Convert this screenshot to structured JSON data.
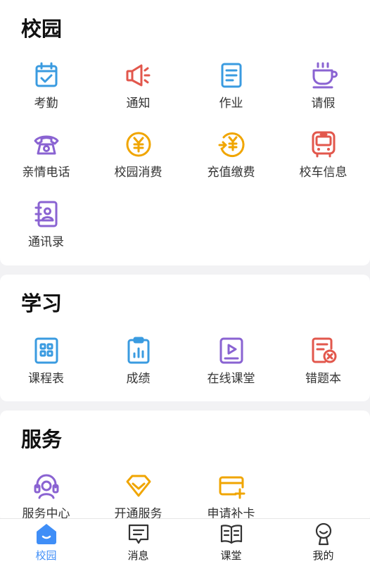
{
  "campus": {
    "title": "校园",
    "items": [
      {
        "label": "考勤",
        "icon": "calendar-check-icon",
        "color": "#3a9be0"
      },
      {
        "label": "通知",
        "icon": "megaphone-icon",
        "color": "#e2574c"
      },
      {
        "label": "作业",
        "icon": "document-list-icon",
        "color": "#3a9be0"
      },
      {
        "label": "请假",
        "icon": "coffee-cup-icon",
        "color": "#8a63d2"
      },
      {
        "label": "亲情电话",
        "icon": "telephone-icon",
        "color": "#8a63d2"
      },
      {
        "label": "校园消费",
        "icon": "yen-coin-icon",
        "color": "#f0a500"
      },
      {
        "label": "充值缴费",
        "icon": "yen-recharge-icon",
        "color": "#f0a500"
      },
      {
        "label": "校车信息",
        "icon": "bus-icon",
        "color": "#e2574c"
      },
      {
        "label": "通讯录",
        "icon": "contact-book-icon",
        "color": "#8a63d2"
      }
    ]
  },
  "study": {
    "title": "学习",
    "items": [
      {
        "label": "课程表",
        "icon": "timetable-grid-icon",
        "color": "#3a9be0"
      },
      {
        "label": "成绩",
        "icon": "score-chart-icon",
        "color": "#3a9be0"
      },
      {
        "label": "在线课堂",
        "icon": "video-play-icon",
        "color": "#8a63d2"
      },
      {
        "label": "错题本",
        "icon": "wrong-notebook-icon",
        "color": "#e2574c"
      }
    ]
  },
  "service": {
    "title": "服务",
    "items": [
      {
        "label": "服务中心",
        "icon": "headset-icon",
        "color": "#8a63d2"
      },
      {
        "label": "开通服务",
        "icon": "diamond-icon",
        "color": "#f0a500"
      },
      {
        "label": "申请补卡",
        "icon": "card-add-icon",
        "color": "#f0a500"
      }
    ]
  },
  "tabbar": {
    "active_color": "#3f8ef7",
    "tabs": [
      {
        "label": "校园",
        "icon": "home-icon",
        "active": true
      },
      {
        "label": "消息",
        "icon": "message-icon",
        "active": false
      },
      {
        "label": "课堂",
        "icon": "open-book-icon",
        "active": false
      },
      {
        "label": "我的",
        "icon": "user-icon",
        "active": false
      }
    ]
  }
}
